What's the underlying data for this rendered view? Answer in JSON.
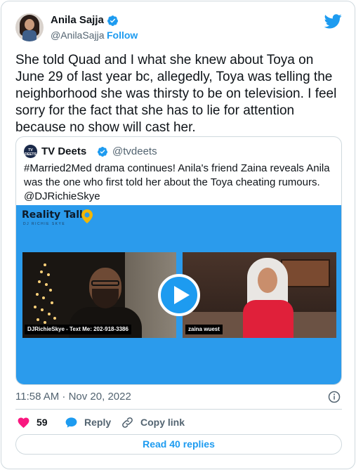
{
  "author": {
    "name": "Anila Sajja",
    "handle": "@AnilaSajja",
    "separator": "·",
    "follow_label": "Follow"
  },
  "tweet": {
    "text": "She told Quad and I what she knew about Toya on June 29 of last year bc, allegedly, Toya was telling the neighborhood she was thirsty to be on television. I feel sorry for the fact that she has to lie for attention because no show will cast her.",
    "timestamp": "11:58 AM · Nov 20, 2022"
  },
  "quote": {
    "avatar_text": "TV DEETS",
    "name": "TV Deets",
    "handle": "@tvdeets",
    "text": "#Married2Med drama continues! Anila's friend Zaina reveals Anila was the one who first told her about the Toya cheating rumours. @DJRichieSkye",
    "video": {
      "logo_title": "Reality Talk",
      "logo_subtitle": "DJ RICHIE SKYE",
      "left_caption": "DJRichieSkye - Text Me: 202-918-3386",
      "right_caption": "zaina wuest"
    }
  },
  "actions": {
    "like_count": "59",
    "reply_label": "Reply",
    "copy_label": "Copy link",
    "read_replies_label": "Read 40 replies"
  },
  "colors": {
    "accent": "#1d9bf0",
    "like": "#f91880",
    "text_secondary": "#536471",
    "video_bg": "#2b9bec"
  },
  "icons": [
    "verified-icon",
    "twitter-bird-icon",
    "play-icon",
    "info-icon",
    "heart-icon",
    "reply-bubble-icon",
    "link-icon",
    "map-pin-icon"
  ]
}
